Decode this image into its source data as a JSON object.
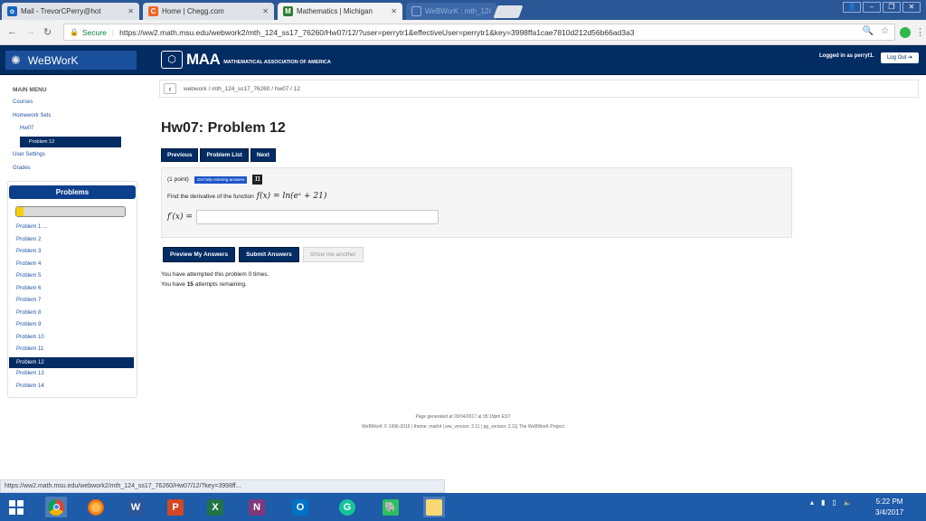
{
  "browser": {
    "tabs": [
      {
        "label": "Mail - TrevorCPerry@hot",
        "icon_color": "#1565c0",
        "icon_text": "o"
      },
      {
        "label": "Home | Chegg.com",
        "icon_color": "#f26522",
        "icon_text": "C"
      },
      {
        "label": "Mathematics | Michigan",
        "icon_color": "#2e7d32",
        "icon_text": "M"
      },
      {
        "label": "WeBWorK : mth_124_ss1",
        "icon_color": "#3d68a8",
        "icon_text": ""
      }
    ],
    "secure_label": "Secure",
    "url": "https://ww2.math.msu.edu/webwork2/mth_124_ss17_76260/Hw07/12/?user=perrytr1&effectiveUser=perrytr1&key=3998ffa1cae7810d212d56b66ad3a3",
    "status_url": "https://ww2.math.msu.edu/webwork2/mth_124_ss17_76260/Hw07/12/?key=3998ff..."
  },
  "header": {
    "brand": "WeBWorK",
    "maa_big": "MAA",
    "maa_small": "MATHEMATICAL ASSOCIATION OF AMERICA",
    "logged_in": "Logged in as perryt1.",
    "logout": "Log Out"
  },
  "sidebar": {
    "title": "MAIN MENU",
    "courses": "Courses",
    "homework_sets": "Homework Sets",
    "hw07": "Hw07",
    "problem12": "Problem 12",
    "user_settings": "User Settings",
    "grades": "Grades"
  },
  "problems_panel": {
    "title": "Problems",
    "progress_fraction": 0.07,
    "items": [
      "Problem 1 ...",
      "Problem 2",
      "Problem 3",
      "Problem 4",
      "Problem 5",
      "Problem 6",
      "Problem 7",
      "Problem 8",
      "Problem 9",
      "Problem 10",
      "Problem 11",
      "Problem 12",
      "Problem 13",
      "Problem 14"
    ],
    "active_index": 11
  },
  "breadcrumb": "webwork / mth_124_ss17_76260 / hw07 / 12",
  "page_title": "Hw07: Problem 12",
  "nav_buttons": {
    "previous": "Previous",
    "problem_list": "Problem List",
    "next": "Next"
  },
  "problem": {
    "points": "(1 point)",
    "help_button": "Get help entering answers",
    "question_prefix": "Find the derivative of the function",
    "function": "f(x) = ln(eˣ + 21)",
    "answer_label": "f′(x) =",
    "answer_value": ""
  },
  "actions": {
    "preview": "Preview My Answers",
    "submit": "Submit Answers",
    "show_another": "Show me another"
  },
  "attempts": {
    "line1": "You have attempted this problem 0 times.",
    "line2_pre": "You have ",
    "line2_num": "15",
    "line2_post": " attempts remaining."
  },
  "footer": {
    "line1": "Page generated at 03/04/2017 at 05:19pm EST",
    "line2": "WeBWorK © 1996-2016 | theme: math4 | ww_version: 2.11 | pg_version: 2.11| The WeBWorK Project"
  },
  "taskbar": {
    "time": "5:22 PM",
    "date": "3/4/2017"
  }
}
